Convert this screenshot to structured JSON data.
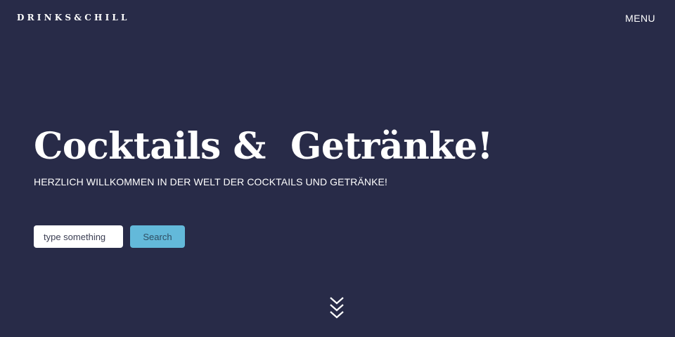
{
  "nav": {
    "logo": "DRINKS&CHILL",
    "menu_label": "MENU"
  },
  "hero": {
    "title": "Cocktails &  Getränke!",
    "subtitle": "HERZLICH WILLKOMMEN IN DER WELT DER COCKTAILS UND GETRÄNKE!"
  },
  "search": {
    "value": "",
    "placeholder": "type something",
    "button_label": "Search"
  },
  "scroll_indicator": {
    "icon": "triple-chevron-down-icon"
  },
  "colors": {
    "background": "#282b48",
    "text": "#ffffff",
    "accent": "#63b9da"
  }
}
